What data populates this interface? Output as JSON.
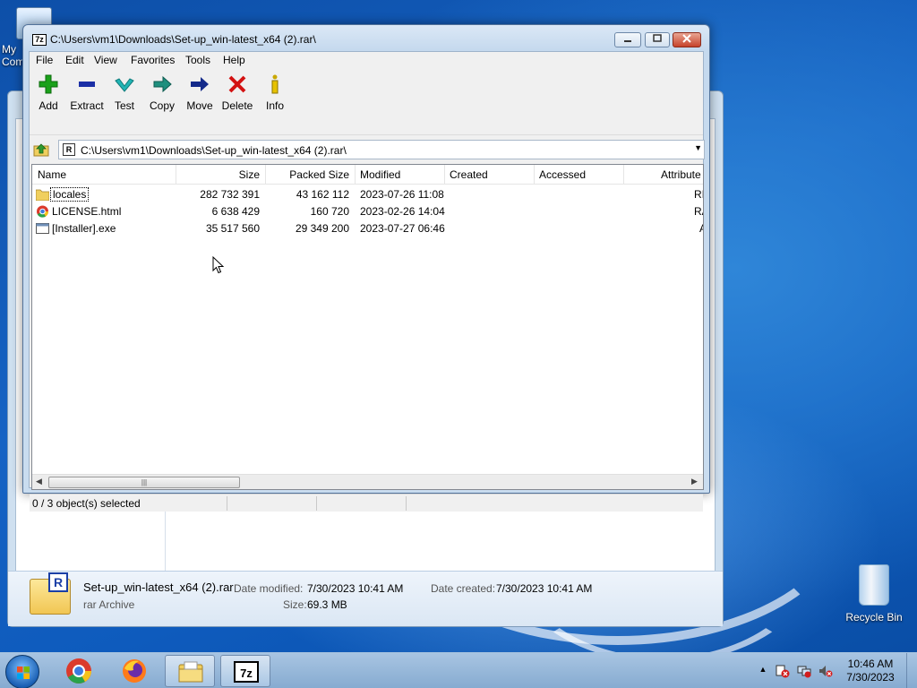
{
  "desktop": {
    "icons": [
      {
        "label": "My Computer"
      },
      {
        "label": "Recycle Bin"
      }
    ]
  },
  "explorer_behind": {
    "details": {
      "file_name": "Set-up_win-latest_x64 (2).rar",
      "file_type": "rar Archive",
      "date_modified_label": "Date modified:",
      "date_modified": "7/30/2023 10:41 AM",
      "date_created_label": "Date created:",
      "date_created": "7/30/2023 10:41 AM",
      "size_label": "Size:",
      "size": "69.3 MB"
    }
  },
  "sevenzip": {
    "app_icon": "7z",
    "title": "C:\\Users\\vm1\\Downloads\\Set-up_win-latest_x64 (2).rar\\",
    "menu": [
      "File",
      "Edit",
      "View",
      "Favorites",
      "Tools",
      "Help"
    ],
    "toolbar": [
      {
        "label": "Add",
        "icon": "plus-icon",
        "color": "#1aa11a"
      },
      {
        "label": "Extract",
        "icon": "minus-icon",
        "color": "#1b2fa6"
      },
      {
        "label": "Test",
        "icon": "check-icon",
        "color": "#21a6a6"
      },
      {
        "label": "Copy",
        "icon": "copy-arrow-icon",
        "color": "#1f8f7e"
      },
      {
        "label": "Move",
        "icon": "move-arrow-icon",
        "color": "#142a8a"
      },
      {
        "label": "Delete",
        "icon": "x-icon",
        "color": "#d31212"
      },
      {
        "label": "Info",
        "icon": "info-icon",
        "color": "#c9a800"
      }
    ],
    "address": "C:\\Users\\vm1\\Downloads\\Set-up_win-latest_x64 (2).rar\\",
    "columns": [
      "Name",
      "Size",
      "Packed Size",
      "Modified",
      "Created",
      "Accessed",
      "Attribute"
    ],
    "rows": [
      {
        "name": "locales",
        "icon": "folder-icon",
        "size": "282 732 391",
        "packed": "43 162 112",
        "modified": "2023-07-26 11:08",
        "created": "",
        "accessed": "",
        "attr": "RI"
      },
      {
        "name": "LICENSE.html",
        "icon": "chrome-html-icon",
        "size": "6 638 429",
        "packed": "160 720",
        "modified": "2023-02-26 14:04",
        "created": "",
        "accessed": "",
        "attr": "RA"
      },
      {
        "name": "[Installer].exe",
        "icon": "exe-icon",
        "size": "35 517 560",
        "packed": "29 349 200",
        "modified": "2023-07-27 06:46",
        "created": "",
        "accessed": "",
        "attr": "A"
      }
    ],
    "status": "0 / 3 object(s) selected"
  },
  "taskbar": {
    "apps": [
      "chrome-icon",
      "firefox-icon",
      "file-explorer-icon",
      "7zip-icon"
    ],
    "active_app": "7zip-icon",
    "time": "10:46 AM",
    "date": "7/30/2023"
  }
}
